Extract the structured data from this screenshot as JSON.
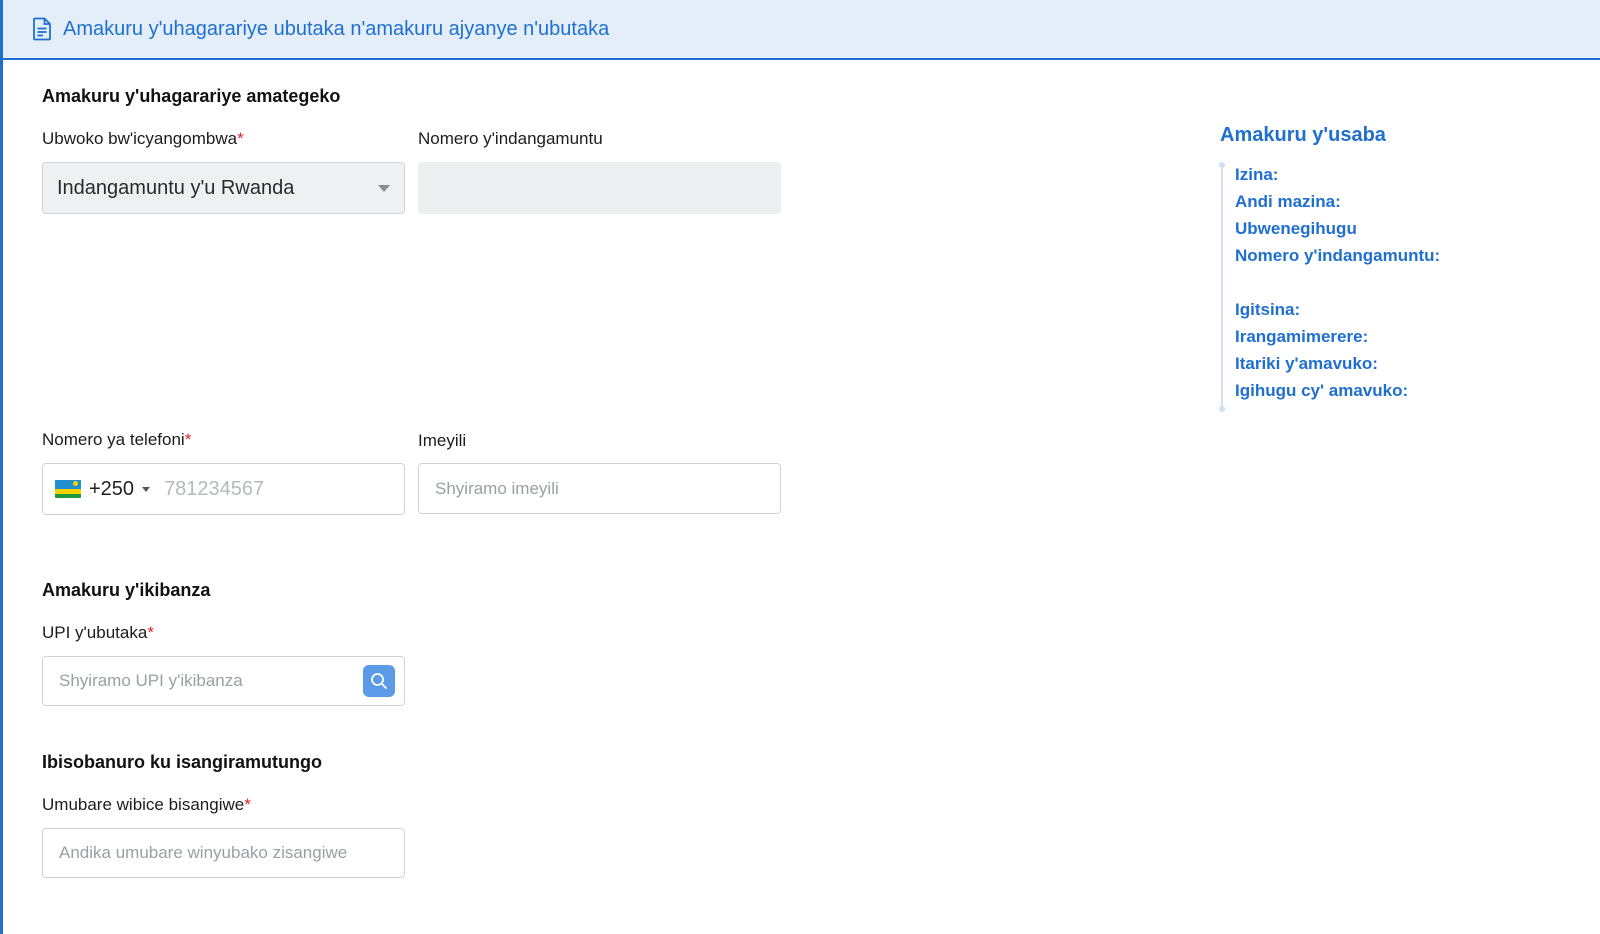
{
  "header": {
    "title": "Amakuru y'uhagarariye ubutaka n'amakuru ajyanye n'ubutaka",
    "icon": "document-icon"
  },
  "legal_rep": {
    "section_title": "Amakuru y'uhagarariye amategeko",
    "id_type": {
      "label": "Ubwoko bw'icyangombwa",
      "required_mark": "*",
      "value": "Indangamuntu y'u Rwanda"
    },
    "id_number": {
      "label": "Nomero y'indangamuntu",
      "value": ""
    },
    "phone": {
      "label": "Nomero ya telefoni",
      "required_mark": "*",
      "country_code": "+250",
      "placeholder": "781234567"
    },
    "email": {
      "label": "Imeyili",
      "placeholder": "Shyiramo imeyili"
    }
  },
  "parcel": {
    "section_title": "Amakuru y'ikibanza",
    "upi": {
      "label": "UPI y'ubutaka",
      "required_mark": "*",
      "placeholder": "Shyiramo UPI y'ikibanza"
    }
  },
  "coownership": {
    "section_title": "Ibisobanuro ku isangiramutungo",
    "units": {
      "label": "Umubare wibice bisangiwe",
      "required_mark": "*",
      "placeholder": "Andika umubare winyubako zisangiwe"
    }
  },
  "applicant_panel": {
    "title": "Amakuru y'usaba",
    "items": [
      "Izina:",
      "Andi mazina:",
      "Ubwenegihugu",
      "Nomero y'indangamuntu:",
      "Igitsina:",
      "Irangamimerere:",
      "Itariki y'amavuko:",
      "Igihugu cy' amavuko:"
    ]
  },
  "colors": {
    "accent": "#1f6fd1",
    "header_bg": "#e4eef9",
    "required": "#e0242c",
    "search_button": "#5b9ae6"
  }
}
